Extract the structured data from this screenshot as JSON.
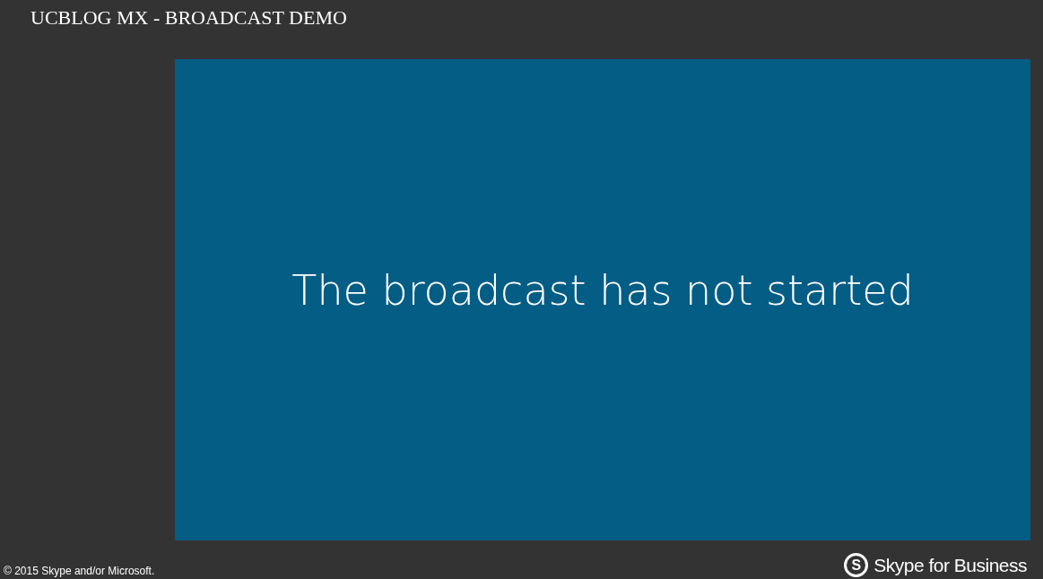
{
  "header": {
    "title": "UCBLOG MX - BROADCAST DEMO"
  },
  "player": {
    "message": "The broadcast has not started"
  },
  "footer": {
    "copyright": "© 2015 Skype and/or Microsoft.",
    "logo_mark": "S",
    "logo_text": "Skype for Business"
  }
}
